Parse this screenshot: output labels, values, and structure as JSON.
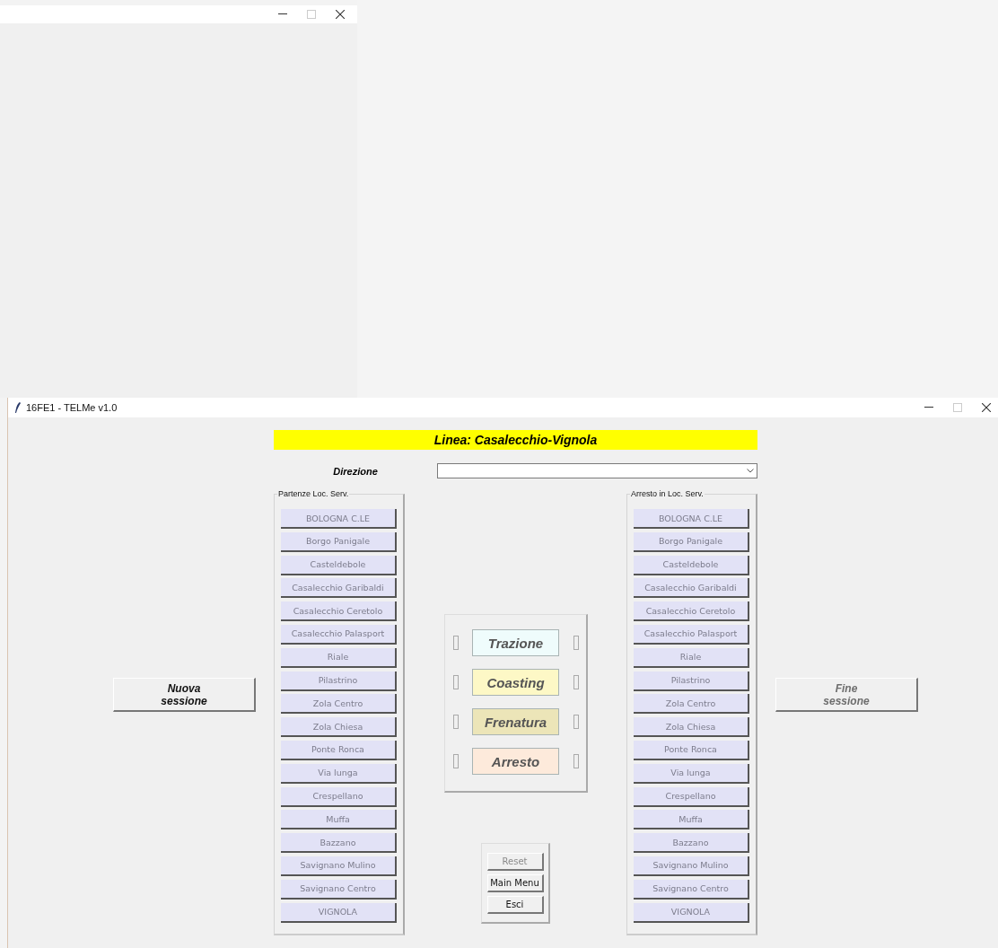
{
  "window": {
    "title": "16FE1 - TELMe v1.0"
  },
  "line_banner": "Linea: Casalecchio-Vignola",
  "direction": {
    "label": "Direzione"
  },
  "session_buttons": [
    {
      "label": "Nuova\nsessione",
      "disabled": false
    },
    {
      "label": "Fine\nsessione",
      "disabled": true
    }
  ],
  "departure_panel": {
    "title": "Partenze Loc. Serv.",
    "stations": [
      {
        "label": "BOLOGNA C.LE",
        "disabled": true
      },
      {
        "label": "Borgo Panigale",
        "disabled": true
      },
      {
        "label": "Casteldebole",
        "disabled": true
      },
      {
        "label": "Casalecchio Garibaldi",
        "disabled": true
      },
      {
        "label": "Casalecchio Ceretolo",
        "disabled": true
      },
      {
        "label": "Casalecchio Palasport",
        "disabled": true
      },
      {
        "label": "Riale",
        "disabled": true
      },
      {
        "label": "Pilastrino",
        "disabled": true
      },
      {
        "label": "Zola Centro",
        "disabled": true
      },
      {
        "label": "Zola Chiesa",
        "disabled": true
      },
      {
        "label": "Ponte Ronca",
        "disabled": true
      },
      {
        "label": "Via lunga",
        "disabled": true
      },
      {
        "label": "Crespellano",
        "disabled": true
      },
      {
        "label": "Muffa",
        "disabled": true
      },
      {
        "label": "Bazzano",
        "disabled": true
      },
      {
        "label": "Savignano Mulino",
        "disabled": true
      },
      {
        "label": "Savignano Centro",
        "disabled": true
      },
      {
        "label": "VIGNOLA",
        "disabled": true
      }
    ]
  },
  "modes": [
    {
      "label": "Trazione",
      "color": "#effcfc"
    },
    {
      "label": "Coasting",
      "color": "#fdf8c6"
    },
    {
      "label": "Frenatura",
      "color": "#ece5b8"
    },
    {
      "label": "Arresto",
      "color": "#fdeadb"
    }
  ],
  "controls": [
    {
      "label": "Reset",
      "disabled": true
    },
    {
      "label": "Main Menu",
      "disabled": false
    },
    {
      "label": "Esci",
      "disabled": false
    }
  ],
  "arrival_panel": {
    "title": "Arresto in Loc. Serv.",
    "stations": [
      {
        "label": "BOLOGNA C.LE",
        "disabled": true
      },
      {
        "label": "Borgo Panigale",
        "disabled": true
      },
      {
        "label": "Casteldebole",
        "disabled": true
      },
      {
        "label": "Casalecchio Garibaldi",
        "disabled": true
      },
      {
        "label": "Casalecchio Ceretolo",
        "disabled": true
      },
      {
        "label": "Casalecchio Palasport",
        "disabled": true
      },
      {
        "label": "Riale",
        "disabled": true
      },
      {
        "label": "Pilastrino",
        "disabled": true
      },
      {
        "label": "Zola Centro",
        "disabled": true
      },
      {
        "label": "Zola Chiesa",
        "disabled": true
      },
      {
        "label": "Ponte Ronca",
        "disabled": true
      },
      {
        "label": "Via lunga",
        "disabled": true
      },
      {
        "label": "Crespellano",
        "disabled": true
      },
      {
        "label": "Muffa",
        "disabled": true
      },
      {
        "label": "Bazzano",
        "disabled": true
      },
      {
        "label": "Savignano Mulino",
        "disabled": true
      },
      {
        "label": "Savignano Centro",
        "disabled": true
      },
      {
        "label": "VIGNOLA",
        "disabled": true
      }
    ]
  }
}
